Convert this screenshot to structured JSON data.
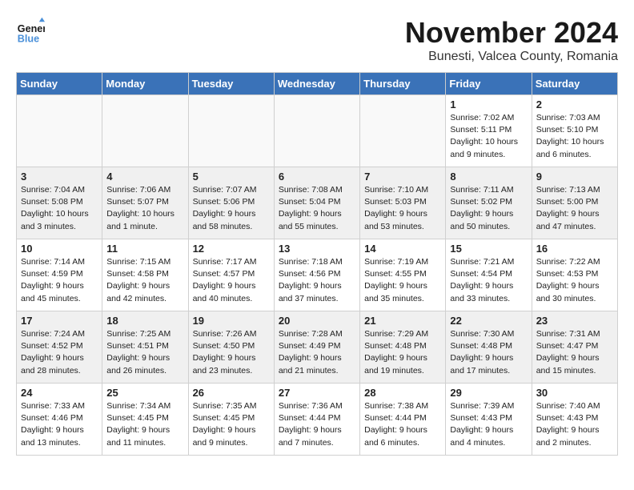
{
  "header": {
    "logo_line1": "General",
    "logo_line2": "Blue",
    "title": "November 2024",
    "subtitle": "Bunesti, Valcea County, Romania"
  },
  "weekdays": [
    "Sunday",
    "Monday",
    "Tuesday",
    "Wednesday",
    "Thursday",
    "Friday",
    "Saturday"
  ],
  "weeks": [
    [
      {
        "day": "",
        "info": ""
      },
      {
        "day": "",
        "info": ""
      },
      {
        "day": "",
        "info": ""
      },
      {
        "day": "",
        "info": ""
      },
      {
        "day": "",
        "info": ""
      },
      {
        "day": "1",
        "info": "Sunrise: 7:02 AM\nSunset: 5:11 PM\nDaylight: 10 hours\nand 9 minutes."
      },
      {
        "day": "2",
        "info": "Sunrise: 7:03 AM\nSunset: 5:10 PM\nDaylight: 10 hours\nand 6 minutes."
      }
    ],
    [
      {
        "day": "3",
        "info": "Sunrise: 7:04 AM\nSunset: 5:08 PM\nDaylight: 10 hours\nand 3 minutes."
      },
      {
        "day": "4",
        "info": "Sunrise: 7:06 AM\nSunset: 5:07 PM\nDaylight: 10 hours\nand 1 minute."
      },
      {
        "day": "5",
        "info": "Sunrise: 7:07 AM\nSunset: 5:06 PM\nDaylight: 9 hours\nand 58 minutes."
      },
      {
        "day": "6",
        "info": "Sunrise: 7:08 AM\nSunset: 5:04 PM\nDaylight: 9 hours\nand 55 minutes."
      },
      {
        "day": "7",
        "info": "Sunrise: 7:10 AM\nSunset: 5:03 PM\nDaylight: 9 hours\nand 53 minutes."
      },
      {
        "day": "8",
        "info": "Sunrise: 7:11 AM\nSunset: 5:02 PM\nDaylight: 9 hours\nand 50 minutes."
      },
      {
        "day": "9",
        "info": "Sunrise: 7:13 AM\nSunset: 5:00 PM\nDaylight: 9 hours\nand 47 minutes."
      }
    ],
    [
      {
        "day": "10",
        "info": "Sunrise: 7:14 AM\nSunset: 4:59 PM\nDaylight: 9 hours\nand 45 minutes."
      },
      {
        "day": "11",
        "info": "Sunrise: 7:15 AM\nSunset: 4:58 PM\nDaylight: 9 hours\nand 42 minutes."
      },
      {
        "day": "12",
        "info": "Sunrise: 7:17 AM\nSunset: 4:57 PM\nDaylight: 9 hours\nand 40 minutes."
      },
      {
        "day": "13",
        "info": "Sunrise: 7:18 AM\nSunset: 4:56 PM\nDaylight: 9 hours\nand 37 minutes."
      },
      {
        "day": "14",
        "info": "Sunrise: 7:19 AM\nSunset: 4:55 PM\nDaylight: 9 hours\nand 35 minutes."
      },
      {
        "day": "15",
        "info": "Sunrise: 7:21 AM\nSunset: 4:54 PM\nDaylight: 9 hours\nand 33 minutes."
      },
      {
        "day": "16",
        "info": "Sunrise: 7:22 AM\nSunset: 4:53 PM\nDaylight: 9 hours\nand 30 minutes."
      }
    ],
    [
      {
        "day": "17",
        "info": "Sunrise: 7:24 AM\nSunset: 4:52 PM\nDaylight: 9 hours\nand 28 minutes."
      },
      {
        "day": "18",
        "info": "Sunrise: 7:25 AM\nSunset: 4:51 PM\nDaylight: 9 hours\nand 26 minutes."
      },
      {
        "day": "19",
        "info": "Sunrise: 7:26 AM\nSunset: 4:50 PM\nDaylight: 9 hours\nand 23 minutes."
      },
      {
        "day": "20",
        "info": "Sunrise: 7:28 AM\nSunset: 4:49 PM\nDaylight: 9 hours\nand 21 minutes."
      },
      {
        "day": "21",
        "info": "Sunrise: 7:29 AM\nSunset: 4:48 PM\nDaylight: 9 hours\nand 19 minutes."
      },
      {
        "day": "22",
        "info": "Sunrise: 7:30 AM\nSunset: 4:48 PM\nDaylight: 9 hours\nand 17 minutes."
      },
      {
        "day": "23",
        "info": "Sunrise: 7:31 AM\nSunset: 4:47 PM\nDaylight: 9 hours\nand 15 minutes."
      }
    ],
    [
      {
        "day": "24",
        "info": "Sunrise: 7:33 AM\nSunset: 4:46 PM\nDaylight: 9 hours\nand 13 minutes."
      },
      {
        "day": "25",
        "info": "Sunrise: 7:34 AM\nSunset: 4:45 PM\nDaylight: 9 hours\nand 11 minutes."
      },
      {
        "day": "26",
        "info": "Sunrise: 7:35 AM\nSunset: 4:45 PM\nDaylight: 9 hours\nand 9 minutes."
      },
      {
        "day": "27",
        "info": "Sunrise: 7:36 AM\nSunset: 4:44 PM\nDaylight: 9 hours\nand 7 minutes."
      },
      {
        "day": "28",
        "info": "Sunrise: 7:38 AM\nSunset: 4:44 PM\nDaylight: 9 hours\nand 6 minutes."
      },
      {
        "day": "29",
        "info": "Sunrise: 7:39 AM\nSunset: 4:43 PM\nDaylight: 9 hours\nand 4 minutes."
      },
      {
        "day": "30",
        "info": "Sunrise: 7:40 AM\nSunset: 4:43 PM\nDaylight: 9 hours\nand 2 minutes."
      }
    ]
  ]
}
